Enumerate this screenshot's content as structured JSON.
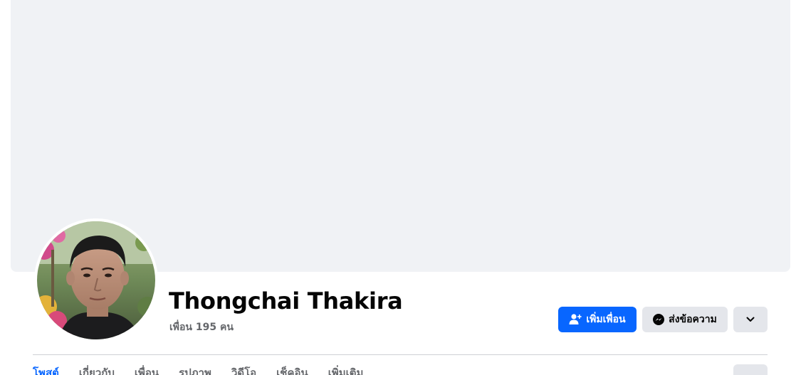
{
  "profile": {
    "name": "Thongchai Thakira",
    "friends_count": "เพื่อน 195 คน"
  },
  "actions": {
    "add_friend_label": "เพิ่มเพื่อน",
    "message_label": "ส่งข้อความ"
  },
  "tabs": [
    {
      "label": "โพสต์"
    },
    {
      "label": "เกี่ยวกับ"
    },
    {
      "label": "เพื่อน"
    },
    {
      "label": "รูปภาพ"
    },
    {
      "label": "วิดีโอ"
    },
    {
      "label": "เช็คอิน"
    },
    {
      "label": "เพิ่มเติม"
    }
  ],
  "colors": {
    "primary": "#0866ff",
    "cover_bg": "#f0f2f5",
    "secondary_button": "#e4e6eb",
    "secondary_text": "#65676b"
  },
  "icons": {
    "add_friend": "person-plus-icon",
    "message": "messenger-icon",
    "more": "chevron-down-icon"
  }
}
